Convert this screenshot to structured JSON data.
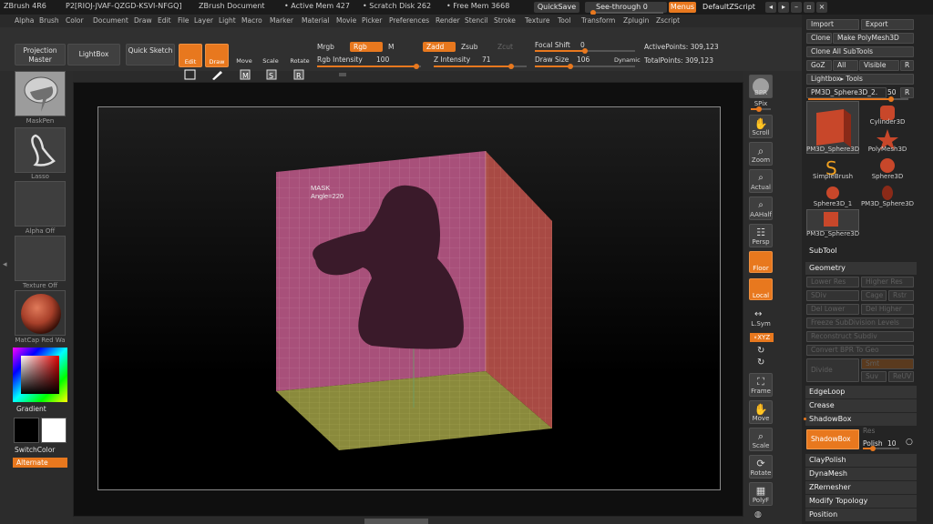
{
  "titlebar": {
    "app": "ZBrush 4R6",
    "doc_id": "P2[RIOJ-JVAF-QZGD-KSVI-NFGQ]",
    "document": "ZBrush Document",
    "active_mem": "• Active Mem 427",
    "scratch_disk": "• Scratch Disk 262",
    "free_mem": "• Free Mem 3668",
    "quicksave": "QuickSave",
    "seethrough": "See-through",
    "seethrough_value": "0",
    "menus": "Menus",
    "default_script": "DefaultZScript"
  },
  "menubar": {
    "items": [
      "Alpha",
      "Brush",
      "Color",
      "Document",
      "Draw",
      "Edit",
      "File",
      "Layer",
      "Light",
      "Macro",
      "Marker",
      "Material",
      "Movie",
      "Picker",
      "Preferences",
      "Render",
      "Stencil",
      "Stroke",
      "Texture",
      "Tool",
      "Transform",
      "Zplugin",
      "Zscript"
    ]
  },
  "shelf": {
    "projection_master": "Projection Master",
    "lightbox": "LightBox",
    "quick_sketch": "Quick Sketch",
    "edit": "Edit",
    "draw": "Draw",
    "move": "Move",
    "scale": "Scale",
    "rotate": "Rotate",
    "mrgb": "Mrgb",
    "rgb": "Rgb",
    "m": "M",
    "rgb_intensity_label": "Rgb Intensity",
    "rgb_intensity_value": "100",
    "zadd": "Zadd",
    "zsub": "Zsub",
    "zcut": "Zcut",
    "z_intensity_label": "Z Intensity",
    "z_intensity_value": "71",
    "focal_shift_label": "Focal Shift",
    "focal_shift_value": "0",
    "draw_size_label": "Draw Size",
    "draw_size_value": "106",
    "dynamic": "Dynamic",
    "active_points": "ActivePoints: 309,123",
    "total_points": "TotalPoints: 309,123"
  },
  "lefttray": {
    "brush": "MaskPen",
    "stroke": "Lasso",
    "alpha": "Alpha Off",
    "texture": "Texture Off",
    "material": "MatCap Red Wa",
    "gradient": "Gradient",
    "switch_color": "SwitchColor",
    "alternate": "Alternate"
  },
  "viewport": {
    "mask_label": "MASK",
    "angle_label": "Angle=220"
  },
  "viewtray": {
    "bpr": "BPR",
    "spix": "SPix",
    "scroll": "Scroll",
    "zoom": "Zoom",
    "actual": "Actual",
    "aahalf": "AAHalf",
    "persp": "Persp",
    "floor": "Floor",
    "local": "Local",
    "lsym": "L.Sym",
    "xyz": "∘XYZ",
    "frame": "Frame",
    "move": "Move",
    "scale": "Scale",
    "rotate": "Rotate",
    "polyf": "PolyF"
  },
  "rightpanel": {
    "import": "Import",
    "export": "Export",
    "clone": "Clone",
    "make_polymesh": "Make PolyMesh3D",
    "clone_all": "Clone All SubTools",
    "goz": "GoZ",
    "all": "All",
    "visible": "Visible",
    "r": "R",
    "lightbox_tools": "Lightbox▸ Tools",
    "current_tool": "PM3D_Sphere3D_2.",
    "current_tool_value": "50",
    "tools": [
      "PM3D_Sphere3D",
      "Cylinder3D",
      "PolyMesh3D",
      "SimpleBrush",
      "Sphere3D",
      "Sphere3D_1",
      "PM3D_Sphere3D",
      "PM3D_Sphere3D"
    ],
    "subtool": "SubTool",
    "geometry": "Geometry",
    "lower_res": "Lower Res",
    "higher_res": "Higher Res",
    "sdiv": "SDiv",
    "cage": "Cage",
    "rstr": "Rstr",
    "del_lower": "Del Lower",
    "del_higher": "Del Higher",
    "freeze": "Freeze SubDivision Levels",
    "reconstruct": "Reconstruct Subdiv",
    "convert_bpr": "Convert BPR To Geo",
    "divide": "Divide",
    "smt": "Smt",
    "suv": "Suv",
    "reuv": "ReUV",
    "edgeloop": "EdgeLoop",
    "crease": "Crease",
    "shadowbox_header": "ShadowBox",
    "res": "Res",
    "shadowbox_button": "ShadowBox",
    "polish_label": "Polish",
    "polish_value": "10",
    "claypolish": "ClayPolish",
    "dynamesh": "DynaMesh",
    "zremesher": "ZRemesher",
    "modify_topology": "Modify Topology",
    "position": "Position"
  },
  "colors": {
    "accent": "#e8781e",
    "mask_face": "#a8507a",
    "side_face": "#a84a44",
    "floor_face": "#8a8a3c",
    "mask_shape": "#3a1a2a"
  }
}
